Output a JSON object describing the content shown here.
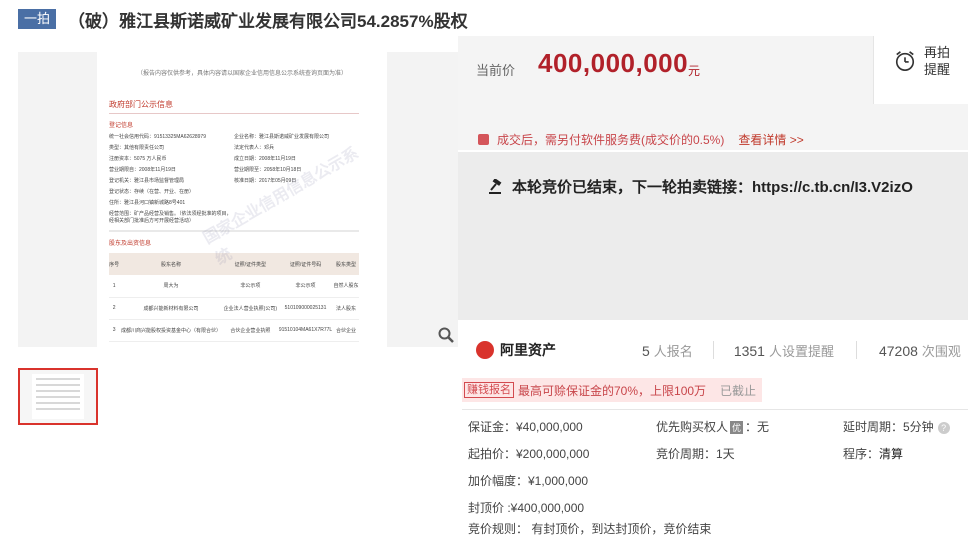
{
  "header": {
    "tag": "一拍",
    "title": "（破）雅江县斯诺威矿业发展有限公司54.2857%股权"
  },
  "doc": {
    "note": "（报告内容仅供参考，具体内容请以国家企业信用信息公示系统查询页面为准）",
    "section_title": "政府部门公示信息",
    "subsection_1": "登记信息",
    "fields": [
      "统一社会信用代码：91513325MA62628979",
      "企业名称：雅江县斯诺威矿业发展有限公司",
      "类型：其他有限责任公司",
      "法定代表人：邓兵",
      "注册资本：5075 万人民币",
      "成立日期：2008年11月19日",
      "营业期限自：2008年11月19日",
      "营业期限至：2058年10月18日",
      "登记机关：雅江县市场监督管理局",
      "核准日期：2017年05月09日",
      "登记状态：存续（在营、开业、在册）",
      "",
      "住所：雅江县河口镇新城路8号401",
      "",
      "经营范围：矿产品经营及销售。（依法须经批准的项目，经相关部门批准后方可开展经营活动）",
      ""
    ],
    "subsection_2": "股东及出资信息",
    "table_headers": [
      "序号",
      "股东名称",
      "证照/证件类型",
      "证照/证件号码",
      "股东类型"
    ],
    "table_rows": [
      [
        "1",
        "周大为",
        "非公示项",
        "非公示项",
        "自然人股东"
      ],
      [
        "2",
        "成都兴能新材料有限公司",
        "企业法人营业执照(公司)",
        "510109000025131",
        "法人股东"
      ],
      [
        "3",
        "成都川商兴能股权投资基金中心（有限合伙）",
        "合伙企业营业执照",
        "91510104MA61X7R77L",
        "合伙企业"
      ]
    ],
    "watermark": "国家企业信用信息公示系统"
  },
  "price": {
    "label": "当前价",
    "value": "400,000,000",
    "unit": "元"
  },
  "remind": {
    "line1": "再拍",
    "line2": "提醒"
  },
  "fee": {
    "text": "成交后，需另付软件服务费(成交价的0.5%)",
    "detail": "查看详情 >>"
  },
  "next_round": {
    "text": "本轮竞价已结束，下一轮拍卖链接：https://c.tb.cn/I3.V2izO"
  },
  "stats": {
    "logo": "阿里资产",
    "signup_count": "5",
    "signup_unit": "人报名",
    "remind_count": "1351",
    "remind_unit": "人设置提醒",
    "view_count": "47208",
    "view_unit": "次围观"
  },
  "notice": {
    "badge": "赚钱报名",
    "text": "最高可赊保证金的70%，上限100万",
    "status": "已截止"
  },
  "info": {
    "deposit": "保证金：¥40,000,000",
    "priority_label": "优先购买权人",
    "priority_badge": "优",
    "priority_value": "：无",
    "delay": "延时周期：5分钟",
    "start_price": "起拍价：¥200,000,000",
    "bid_period": "竞价周期：1天",
    "procedure_label": "程序：",
    "procedure_value": "清算",
    "increment": "加价幅度：¥1,000,000",
    "cap_price": "封顶价 :¥400,000,000",
    "rule": "竞价规则： 有封顶价，到达封顶价，竞价结束"
  }
}
